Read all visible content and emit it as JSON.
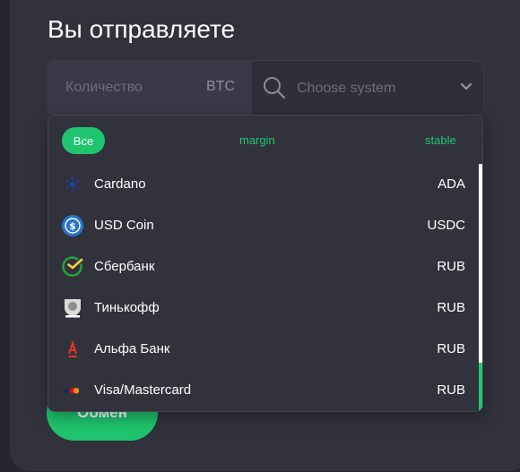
{
  "header": {
    "title": "Вы отправляете"
  },
  "amount": {
    "placeholder": "Количество",
    "currency": "BTC"
  },
  "system": {
    "placeholder": "Choose system"
  },
  "filters": {
    "all": "Все",
    "margin": "margin",
    "stable": "stable"
  },
  "items": [
    {
      "name": "Cardano",
      "code": "ADA",
      "icon": "cardano-icon"
    },
    {
      "name": "USD Coin",
      "code": "USDC",
      "icon": "usd-coin-icon"
    },
    {
      "name": "Сбербанк",
      "code": "RUB",
      "icon": "sberbank-icon"
    },
    {
      "name": "Тинькофф",
      "code": "RUB",
      "icon": "tinkoff-icon"
    },
    {
      "name": "Альфа Банк",
      "code": "RUB",
      "icon": "alfa-bank-icon"
    },
    {
      "name": "Visa/Mastercard",
      "code": "RUB",
      "icon": "visa-mastercard-icon"
    }
  ],
  "actions": {
    "exchange": "Обмен"
  },
  "colors": {
    "accent": "#1fc56e",
    "background": "#32323d",
    "text": "#ffffff"
  }
}
